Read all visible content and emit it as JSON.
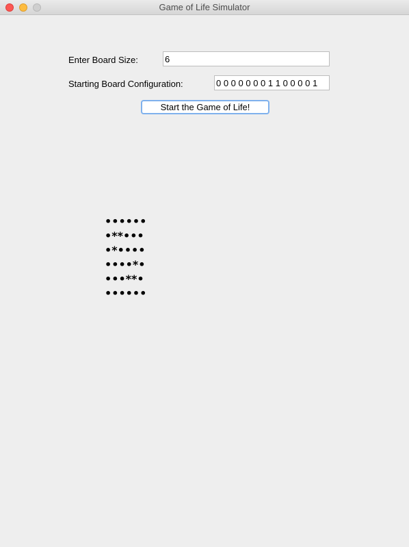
{
  "window": {
    "title": "Game of Life Simulator"
  },
  "form": {
    "board_size_label": "Enter Board Size:",
    "board_size_value": "6",
    "config_label": "Starting Board Configuration:",
    "config_value": "0 0 0 0 0 0 0 1 1 0 0 0 0 1",
    "start_button_label": "Start the Game of Life!"
  },
  "board": {
    "rows": [
      "••••••",
      "•**•••",
      "•*••••",
      "••••*•",
      "•••**•",
      "••••••"
    ]
  }
}
